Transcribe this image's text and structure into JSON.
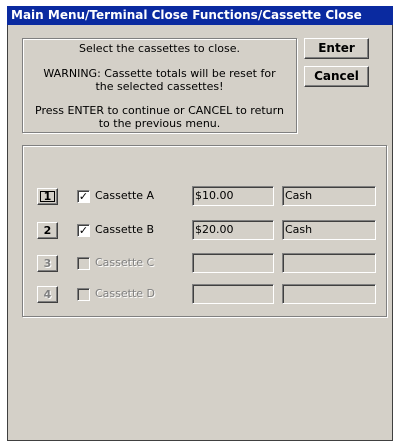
{
  "window": {
    "title": "Main Menu/Terminal Close Functions/Cassette Close"
  },
  "info": {
    "line1": "Select the cassettes to close.",
    "line2": "WARNING: Cassette totals will be reset for the selected cassettes!",
    "line3": "Press ENTER to continue or CANCEL to return to the previous menu."
  },
  "buttons": {
    "enter": "Enter",
    "cancel": "Cancel"
  },
  "cassettes": [
    {
      "number": "1",
      "label": "Cassette A",
      "checked": true,
      "enabled": true,
      "amount": "$10.00",
      "type": "Cash",
      "check_mark": "✓"
    },
    {
      "number": "2",
      "label": "Cassette B",
      "checked": true,
      "enabled": true,
      "amount": "$20.00",
      "type": "Cash",
      "check_mark": "✓"
    },
    {
      "number": "3",
      "label": "Cassette C",
      "checked": false,
      "enabled": false,
      "amount": "",
      "type": "",
      "check_mark": ""
    },
    {
      "number": "4",
      "label": "Cassette D",
      "checked": false,
      "enabled": false,
      "amount": "",
      "type": "",
      "check_mark": ""
    }
  ],
  "colors": {
    "titlebar": "#0a2aa0",
    "face": "#d4d0c8",
    "disabled_text": "#808080"
  }
}
